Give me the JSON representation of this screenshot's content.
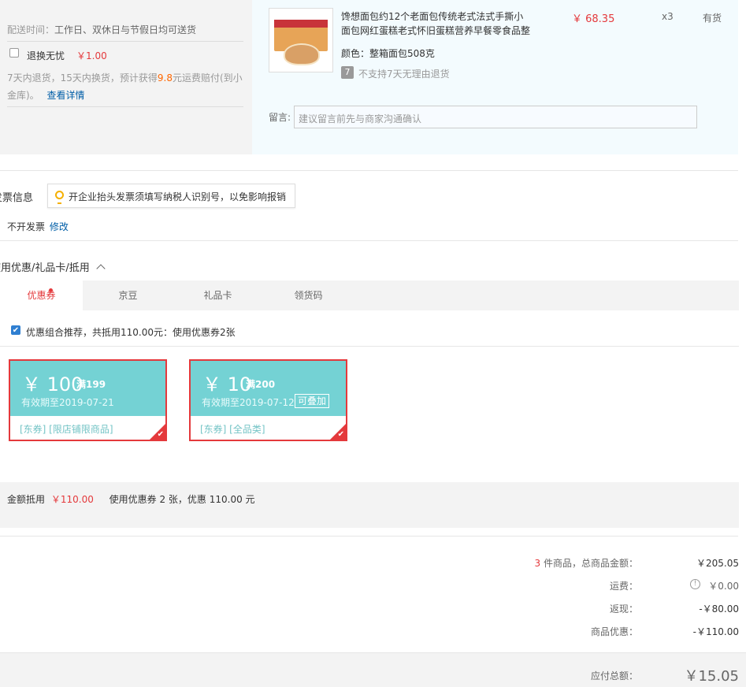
{
  "shipping": {
    "delivery_label": "配送时间：",
    "delivery_value": "工作日、双休日与节假日均可送货",
    "insurance_label": "退换无忧",
    "insurance_price": "￥1.00",
    "insurance_desc_part1": "7天内退货，15天内换货，预计获得",
    "insurance_amount": "9.8",
    "insurance_desc_part2": "元运费赔付(到小",
    "insurance_desc_line2": "金库)。",
    "insurance_link": "查看详情"
  },
  "product": {
    "name_line1": "馋想面包约12个老面包传统老式法式手撕小",
    "name_line2": "面包网红蛋糕老式怀旧蛋糕营养早餐零食品整",
    "price": "￥ 68.35",
    "quantity": "x3",
    "stock": "有货",
    "color": "颜色：整箱面包508克",
    "return_policy": "不支持7天无理由退货",
    "return_icon": "7",
    "remark_label": "留言:",
    "remark_placeholder": "建议留言前先与商家沟通确认"
  },
  "invoice": {
    "title": "发票信息",
    "tip": "开企业抬头发票须填写纳税人识别号，以免影响报销",
    "value": "不开发票",
    "edit_link": "修改"
  },
  "discount": {
    "title": "使用优惠/礼品卡/抵用",
    "toggle_icon": "chevron-up-icon",
    "tabs": [
      "优惠券",
      "京豆",
      "礼品卡",
      "领货码"
    ],
    "recommend_text": "优惠组合推荐，共抵用110.00元：使用优惠券2张",
    "coupons": [
      {
        "currency": "￥",
        "amount": "100",
        "condition": "满199",
        "valid": "有效期至2019-07-21",
        "stack_label": "",
        "tags": "[东券]  [限店铺限商品]"
      },
      {
        "currency": "￥",
        "amount": "10",
        "condition": "满200",
        "valid": "有效期至2019-07-12",
        "stack_label": "可叠加",
        "tags": "[东券]  [全品类]"
      }
    ],
    "summary_label": "金额抵用",
    "summary_amount": "￥110.00",
    "summary_desc": "使用优惠券 2 张，优惠 110.00 元"
  },
  "totals": {
    "count": "3",
    "count_label": "件商品，总商品金额：",
    "goods_amount": "￥205.05",
    "freight_label": "运费：",
    "freight_amount": "￥0.00",
    "cashback_label": "返现：",
    "cashback_amount": "-￥80.00",
    "discount_label": "商品优惠：",
    "discount_amount": "-￥110.00",
    "payable_label": "应付总额：",
    "payable_amount": "￥15.05"
  },
  "colors": {
    "accent": "#e4393c",
    "link": "#005ea7",
    "coupon": "#74d2d4",
    "orange": "#ff6600"
  }
}
